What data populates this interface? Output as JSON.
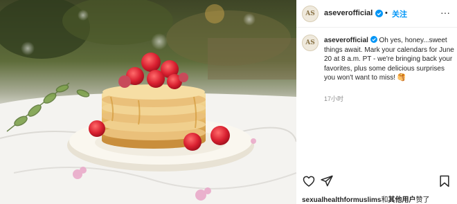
{
  "post": {
    "username": "aseverofficial",
    "follow_label": "关注",
    "separator": "•",
    "avatar_letters": "AS",
    "more_label": "···",
    "caption_text": "Oh yes, honey...sweet things await. Mark your calendars for June 20 at 8 a.m. PT - we're bringing back your favorites, plus some delicious surprises you won't want to miss! 🥞",
    "timestamp": "17小时",
    "likes_user": "sexualhealthformuslims",
    "likes_middle": "和",
    "likes_others": "其他用户",
    "likes_suffix": "赞了"
  },
  "icons": [
    "verified-badge-icon",
    "more-options-icon",
    "heart-icon",
    "share-icon",
    "bookmark-icon"
  ],
  "colors": {
    "accent": "#0095f6",
    "text": "#262626",
    "muted": "#8e8e8e",
    "divider": "#efefef"
  }
}
